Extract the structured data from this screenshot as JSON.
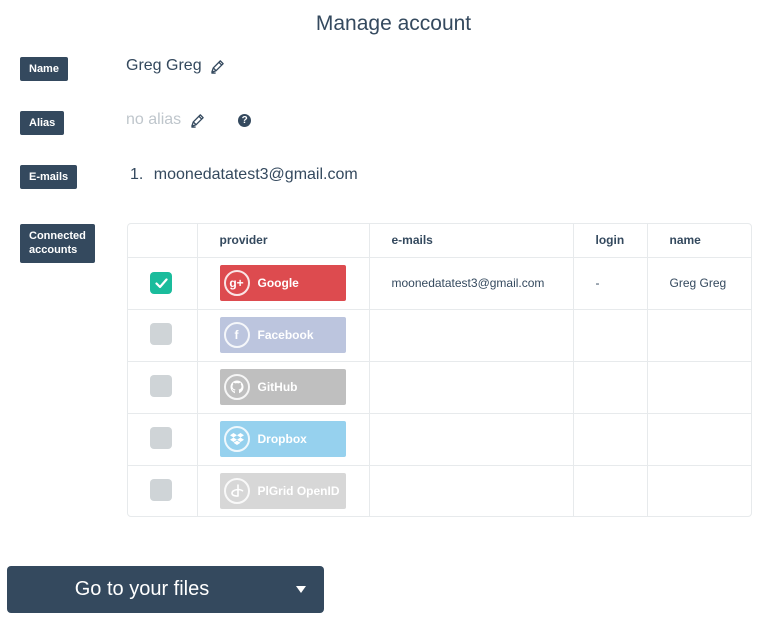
{
  "page": {
    "title": "Manage account"
  },
  "name": {
    "label": "Name",
    "value": "Greg Greg"
  },
  "alias": {
    "label": "Alias",
    "value": "no alias",
    "help": "?"
  },
  "emails": {
    "label": "E-mails",
    "items": [
      {
        "index": "1.",
        "address": "moonedatatest3@gmail.com"
      }
    ]
  },
  "connected": {
    "label_line1": "Connected",
    "label_line2": "accounts",
    "headers": {
      "check": "",
      "provider": "provider",
      "emails": "e-mails",
      "login": "login",
      "name": "name"
    },
    "rows": [
      {
        "provider": "Google",
        "icon": "g+",
        "color": "#dd4b4f",
        "checked": true,
        "email": "moonedatatest3@gmail.com",
        "login": "-",
        "name": "Greg Greg"
      },
      {
        "provider": "Facebook",
        "icon": "f",
        "color": "#bcc5de",
        "checked": false,
        "email": "",
        "login": "",
        "name": ""
      },
      {
        "provider": "GitHub",
        "icon": "github",
        "color": "#bfbfbf",
        "checked": false,
        "email": "",
        "login": "",
        "name": ""
      },
      {
        "provider": "Dropbox",
        "icon": "dropbox",
        "color": "#96d1ee",
        "checked": false,
        "email": "",
        "login": "",
        "name": ""
      },
      {
        "provider": "PlGrid OpenID",
        "icon": "openid",
        "color": "#d7d7d7",
        "checked": false,
        "email": "",
        "login": "",
        "name": ""
      }
    ]
  },
  "footer": {
    "go_button": "Go to your files"
  }
}
